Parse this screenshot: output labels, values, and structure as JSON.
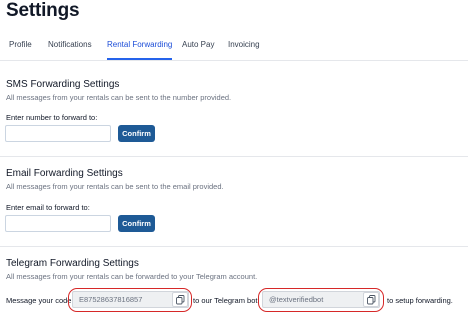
{
  "page": {
    "title": "Settings"
  },
  "tabs": [
    {
      "label": "Profile",
      "active": false
    },
    {
      "label": "Notifications",
      "active": false
    },
    {
      "label": "Rental Forwarding",
      "active": true
    },
    {
      "label": "Auto Pay",
      "active": false
    },
    {
      "label": "Invoicing",
      "active": false
    }
  ],
  "sms": {
    "title": "SMS Forwarding Settings",
    "description": "All messages from your rentals can be sent to the number provided.",
    "field_label": "Enter number to forward to:",
    "input_value": "",
    "input_placeholder": "",
    "confirm_label": "Confirm"
  },
  "email": {
    "title": "Email Forwarding Settings",
    "description": "All messages from your rentals can be sent to the email provided.",
    "field_label": "Enter email to forward to:",
    "input_value": "",
    "input_placeholder": "",
    "confirm_label": "Confirm"
  },
  "telegram": {
    "title": "Telegram Forwarding Settings",
    "description": "All messages from your rentals can be forwarded to your Telegram account.",
    "text_before_code": "Message your code",
    "code": "E87528637816857",
    "text_middle": "to our Telegram bot:",
    "bot": "@textverifiedbot",
    "text_after": "to setup forwarding."
  },
  "colors": {
    "accent": "#2563eb",
    "confirm_button": "#1e5a96",
    "highlight": "#d62828"
  },
  "icons": {
    "copy": "copy-icon"
  }
}
